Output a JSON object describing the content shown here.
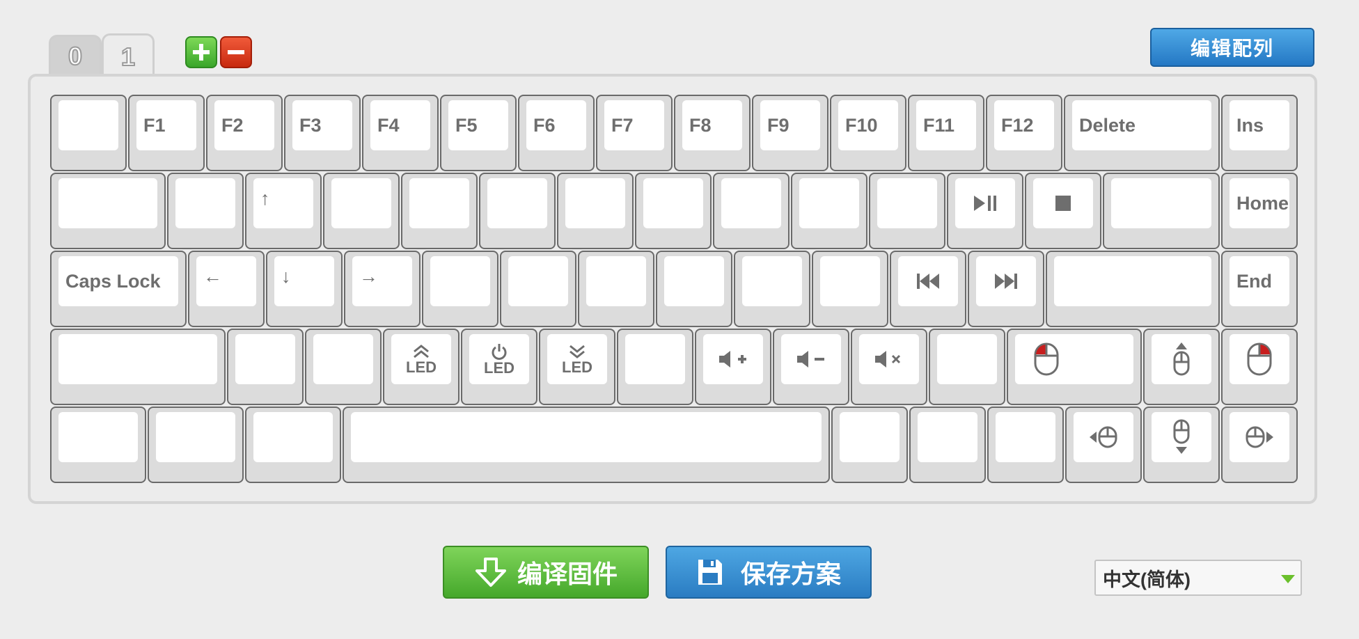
{
  "layer_tabs": [
    {
      "label": "0",
      "active": false
    },
    {
      "label": "1",
      "active": true
    }
  ],
  "layer_controls": {
    "add_icon": "plus-icon",
    "remove_icon": "minus-icon"
  },
  "header": {
    "edit_layout_label": "编辑配列"
  },
  "keyboard": {
    "rows": [
      [
        {
          "label": ""
        },
        {
          "label": "F1"
        },
        {
          "label": "F2"
        },
        {
          "label": "F3"
        },
        {
          "label": "F4"
        },
        {
          "label": "F5"
        },
        {
          "label": "F6"
        },
        {
          "label": "F7"
        },
        {
          "label": "F8"
        },
        {
          "label": "F9"
        },
        {
          "label": "F10"
        },
        {
          "label": "F11"
        },
        {
          "label": "F12"
        },
        {
          "label": "Delete"
        },
        {
          "label": "Ins"
        }
      ],
      [
        {
          "label": ""
        },
        {
          "label": ""
        },
        {
          "label": "↑"
        },
        {
          "label": ""
        },
        {
          "label": ""
        },
        {
          "label": ""
        },
        {
          "label": ""
        },
        {
          "label": ""
        },
        {
          "label": ""
        },
        {
          "label": ""
        },
        {
          "label": ""
        },
        {
          "icon": "play-pause-icon"
        },
        {
          "icon": "stop-icon"
        },
        {
          "label": ""
        },
        {
          "label": "Home"
        }
      ],
      [
        {
          "label": "Caps Lock"
        },
        {
          "label": "←"
        },
        {
          "label": "↓"
        },
        {
          "label": "→"
        },
        {
          "label": ""
        },
        {
          "label": ""
        },
        {
          "label": ""
        },
        {
          "label": ""
        },
        {
          "label": ""
        },
        {
          "label": ""
        },
        {
          "icon": "previous-track-icon"
        },
        {
          "icon": "next-track-icon"
        },
        {
          "label": ""
        },
        {
          "label": "End"
        }
      ],
      [
        {
          "label": ""
        },
        {
          "label": ""
        },
        {
          "label": ""
        },
        {
          "icon": "led-brightness-up-icon",
          "label": "LED"
        },
        {
          "icon": "led-power-icon",
          "label": "LED"
        },
        {
          "icon": "led-brightness-down-icon",
          "label": "LED"
        },
        {
          "label": ""
        },
        {
          "icon": "volume-up-icon"
        },
        {
          "icon": "volume-down-icon"
        },
        {
          "icon": "mute-icon"
        },
        {
          "label": ""
        },
        {
          "icon": "mouse-left-click-icon"
        },
        {
          "icon": "mouse-move-up-icon"
        },
        {
          "icon": "mouse-right-click-icon"
        }
      ],
      [
        {
          "label": ""
        },
        {
          "label": ""
        },
        {
          "label": ""
        },
        {
          "label": ""
        },
        {
          "label": ""
        },
        {
          "label": ""
        },
        {
          "label": ""
        },
        {
          "icon": "mouse-move-left-icon"
        },
        {
          "icon": "mouse-move-down-icon"
        },
        {
          "icon": "mouse-move-right-icon"
        }
      ]
    ]
  },
  "footer": {
    "compile_label": "编译固件",
    "save_label": "保存方案",
    "language_selected": "中文(简体)"
  },
  "colors": {
    "green": "#45a82b",
    "blue": "#2a7cc2",
    "red": "#c82a10"
  }
}
